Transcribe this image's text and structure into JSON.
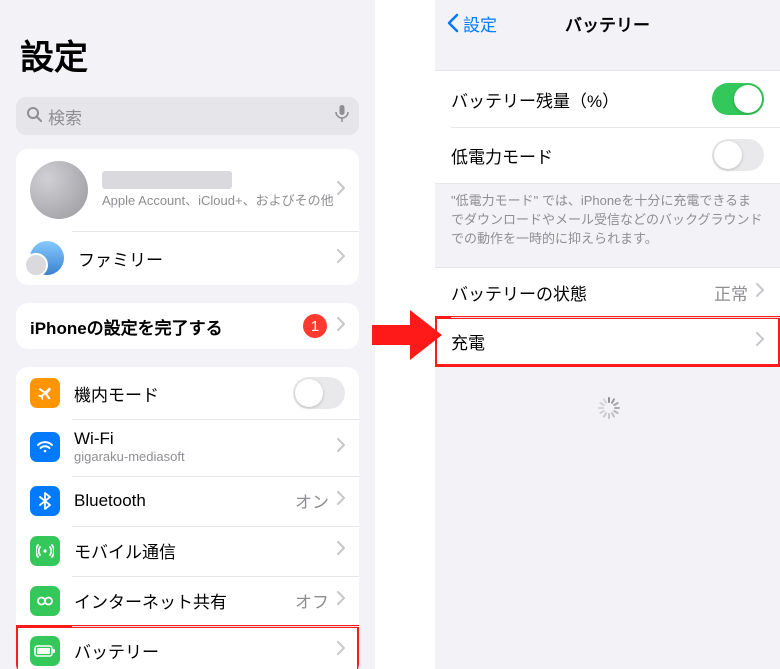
{
  "left": {
    "title": "設定",
    "search": {
      "placeholder": "検索"
    },
    "apple_account": {
      "subtitle": "Apple Account、iCloud+、およびその他"
    },
    "family": {
      "label": "ファミリー"
    },
    "setup": {
      "label": "iPhoneの設定を完了する",
      "badge": "1"
    },
    "rows": {
      "airplane": {
        "label": "機内モード",
        "on": false
      },
      "wifi": {
        "label": "Wi-Fi",
        "value": "gigaraku-mediasoft"
      },
      "bluetooth": {
        "label": "Bluetooth",
        "value": "オン"
      },
      "cellular": {
        "label": "モバイル通信"
      },
      "hotspot": {
        "label": "インターネット共有",
        "value": "オフ"
      },
      "battery": {
        "label": "バッテリー"
      }
    }
  },
  "right": {
    "back": "設定",
    "title": "バッテリー",
    "rows": {
      "percent": {
        "label": "バッテリー残量（%）",
        "on": true
      },
      "lowpower": {
        "label": "低電力モード",
        "on": false
      },
      "health": {
        "label": "バッテリーの状態",
        "value": "正常"
      },
      "charging": {
        "label": "充電"
      }
    },
    "footer": "\"低電力モード\" では、iPhoneを十分に充電できるまでダウンロードやメール受信などのバックグラウンドでの動作を一時的に抑えられます。"
  },
  "colors": {
    "orange": "#ff9500",
    "blue": "#007aff",
    "green": "#34c759",
    "green2": "#30d158"
  }
}
